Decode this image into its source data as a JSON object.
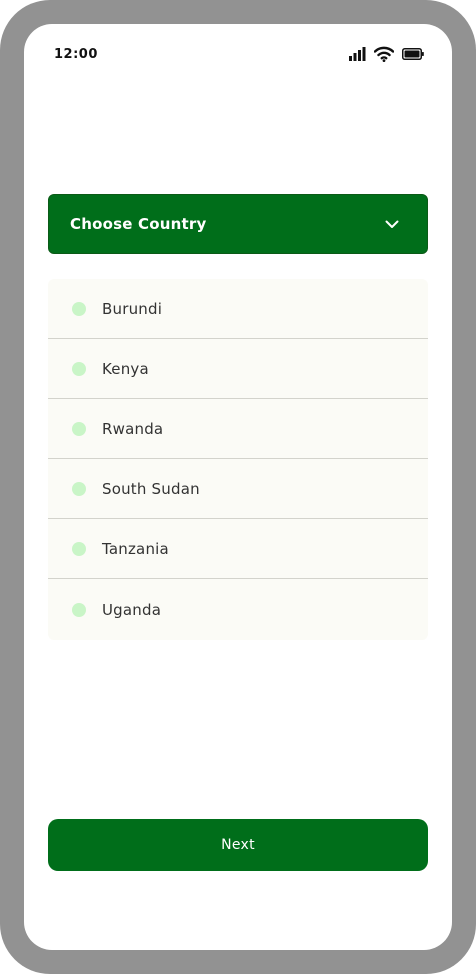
{
  "status_bar": {
    "time": "12:00",
    "icons": [
      "signal-icon",
      "wifi-icon",
      "battery-icon"
    ]
  },
  "dropdown": {
    "label": "Choose Country",
    "icon": "chevron-down-icon",
    "state": "expanded"
  },
  "countries": {
    "items": [
      {
        "label": "Burundi"
      },
      {
        "label": "Kenya"
      },
      {
        "label": "Rwanda"
      },
      {
        "label": "South Sudan"
      },
      {
        "label": "Tanzania"
      },
      {
        "label": "Uganda"
      }
    ]
  },
  "actions": {
    "next_label": "Next"
  },
  "colors": {
    "primary": "#006e1a",
    "list_background": "#fbfbf6",
    "radio_fill": "#c9f5c7",
    "divider": "#d3d3cc",
    "frame": "#929292"
  }
}
